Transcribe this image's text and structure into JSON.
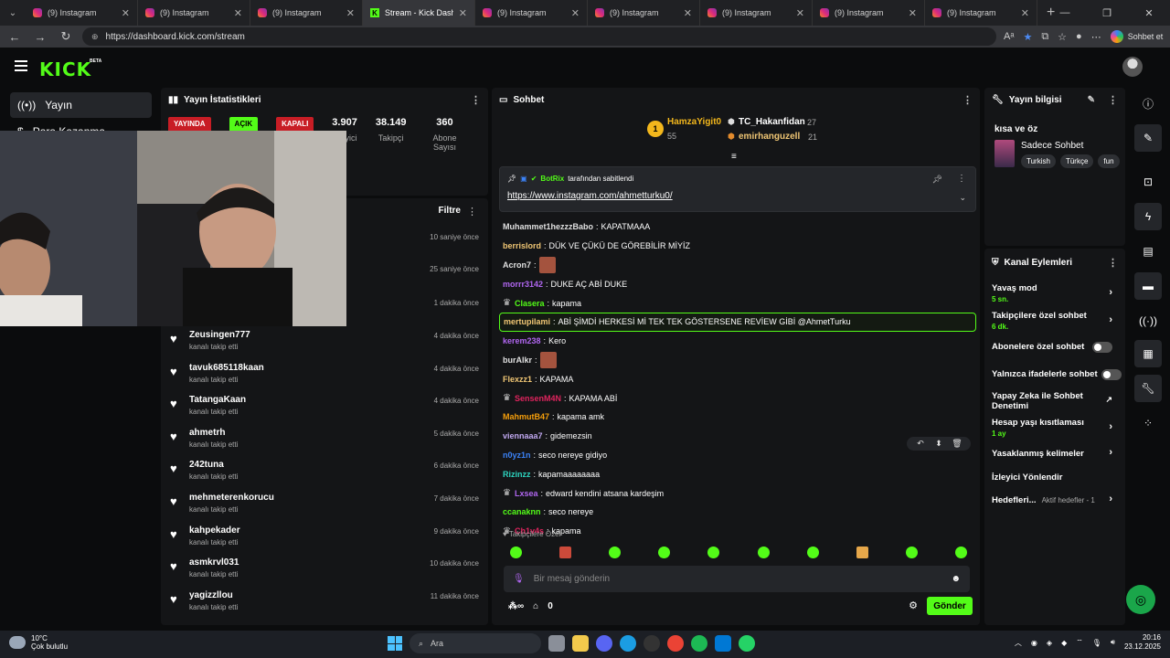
{
  "browser": {
    "tabs": [
      {
        "title": "(9) Instagram",
        "active": false,
        "icon": "instagram-icon"
      },
      {
        "title": "(9) Instagram",
        "active": false,
        "icon": "instagram-icon"
      },
      {
        "title": "(9) Instagram",
        "active": false,
        "icon": "instagram-icon"
      },
      {
        "title": "Stream - Kick Dashboard",
        "active": true,
        "icon": "kick-icon"
      },
      {
        "title": "(9) Instagram",
        "active": false,
        "icon": "instagram-icon"
      },
      {
        "title": "(9) Instagram",
        "active": false,
        "icon": "instagram-icon"
      },
      {
        "title": "(9) Instagram",
        "active": false,
        "icon": "instagram-icon"
      },
      {
        "title": "(9) Instagram",
        "active": false,
        "icon": "instagram-icon"
      },
      {
        "title": "(9) Instagram",
        "active": false,
        "icon": "instagram-icon"
      }
    ],
    "url": "https://dashboard.kick.com/stream",
    "profile_label": "Sohbet et"
  },
  "app": {
    "logo": "KICK",
    "beta": "BETA",
    "nav": {
      "yayin": "Yayın",
      "para": "Para Kazanma"
    }
  },
  "stats": {
    "title": "Yayın İstatistikleri",
    "badge_live": "YAYINDA",
    "badge_open": "AÇIK",
    "badge_closed": "KAPALI",
    "viewers": "3.907",
    "viewers_label": "İzleyici",
    "followers": "38.149",
    "followers_label": "Takipçi",
    "subs": "360",
    "subs_label": "Abone Sayısı"
  },
  "follows": {
    "filter_label": "Filtre",
    "early_times": [
      "10 saniye önce",
      "25 saniye önce",
      "1 dakika önce"
    ],
    "items": [
      {
        "name": "Zeusingen777",
        "sub": "kanalı takip etti",
        "time": "4 dakika önce"
      },
      {
        "name": "tavuk685118kaan",
        "sub": "kanalı takip etti",
        "time": "4 dakika önce"
      },
      {
        "name": "TatangaKaan",
        "sub": "kanalı takip etti",
        "time": "4 dakika önce"
      },
      {
        "name": "ahmetrh",
        "sub": "kanalı takip etti",
        "time": "5 dakika önce"
      },
      {
        "name": "242tuna",
        "sub": "kanalı takip etti",
        "time": "6 dakika önce"
      },
      {
        "name": "mehmeterenkorucu",
        "sub": "kanalı takip etti",
        "time": "7 dakika önce"
      },
      {
        "name": "kahpekader",
        "sub": "kanalı takip etti",
        "time": "9 dakika önce"
      },
      {
        "name": "asmkrvl031",
        "sub": "kanalı takip etti",
        "time": "10 dakika önce"
      },
      {
        "name": "yagizzllou",
        "sub": "kanalı takip etti",
        "time": "11 dakika önce"
      }
    ]
  },
  "chat": {
    "title": "Sohbet",
    "gifters": {
      "first_name": "HamzaYigit0",
      "first_count": "55",
      "first_rank": "1",
      "second_name": "TC_Hakanfidan",
      "second_count": "27",
      "third_name": "emirhanguzell",
      "third_count": "21"
    },
    "pinned": {
      "by": "BotRix",
      "suffix": "tarafından sabitlendi",
      "link": "https://www.instagram.com/ahmetturku0/"
    },
    "messages": [
      {
        "user": "Muhammet1hezzzBabo",
        "text": "KAPATMAAA",
        "color": "#e0e0e0",
        "icon": "",
        "emote": false,
        "highlight": false
      },
      {
        "user": "berrislord",
        "text": "DÜK VE ÇÜKÜ DE GÖREBİLİR MİYİZ",
        "color": "#f0c674",
        "icon": "",
        "emote": false,
        "highlight": false
      },
      {
        "user": "Acron7",
        "text": "",
        "color": "#e0e0e0",
        "icon": "",
        "emote": true,
        "highlight": false
      },
      {
        "user": "morrr3142",
        "text": "DUKE AÇ ABİ DUKE",
        "color": "#b066f0",
        "icon": "",
        "emote": false,
        "highlight": false
      },
      {
        "user": "Clasera",
        "text": "kapama",
        "color": "#53fc18",
        "icon": "crown",
        "emote": false,
        "highlight": false
      },
      {
        "user": "mertupilami",
        "text": "ABİ ŞİMDİ HERKESİ Mİ TEK TEK GÖSTERSENE REVİEW GİBİ @AhmetTurku",
        "color": "#f0c674",
        "icon": "",
        "emote": false,
        "highlight": true
      },
      {
        "user": "kerem238",
        "text": "Kero",
        "color": "#b066f0",
        "icon": "",
        "emote": false,
        "highlight": false
      },
      {
        "user": "burAlkr",
        "text": "",
        "color": "#e0e0e0",
        "icon": "",
        "emote": true,
        "highlight": false
      },
      {
        "user": "Flexzz1",
        "text": "KAPAMA",
        "color": "#f0c674",
        "icon": "",
        "emote": false,
        "highlight": false
      },
      {
        "user": "SensenM4N",
        "text": "KAPAMA ABİ",
        "color": "#e0245e",
        "icon": "crown",
        "emote": false,
        "highlight": false
      },
      {
        "user": "MahmutB47",
        "text": "kapama amk",
        "color": "#f59e0b",
        "icon": "",
        "emote": false,
        "highlight": false
      },
      {
        "user": "viennaaa7",
        "text": "gidemezsin",
        "color": "#c0a8f0",
        "icon": "",
        "emote": false,
        "highlight": false
      },
      {
        "user": "n0yz1n",
        "text": "seco nereye gidiyo",
        "color": "#3b82f6",
        "icon": "",
        "emote": false,
        "highlight": false
      },
      {
        "user": "Rizinzz",
        "text": "kapamaaaaaaaa",
        "color": "#2dd4bf",
        "icon": "",
        "emote": false,
        "highlight": false
      },
      {
        "user": "Lxsea",
        "text": "edward kendini atsana kardeşim",
        "color": "#b066f0",
        "icon": "crown",
        "emote": false,
        "highlight": false
      },
      {
        "user": "ccanaknn",
        "text": "seco nereye",
        "color": "#53fc18",
        "icon": "",
        "emote": false,
        "highlight": false
      },
      {
        "user": "Ch1v4s",
        "text": "kapama",
        "color": "#e0245e",
        "icon": "crown",
        "emote": false,
        "highlight": false
      }
    ],
    "followers_only": "Takipçilere Özel",
    "input_placeholder": "Bir mesaj gönderin",
    "footer_count": "0",
    "send_label": "Gönder"
  },
  "info": {
    "title": "Yayın bilgisi",
    "stream_title": "kısa ve öz",
    "category": "Sadece Sohbet",
    "tags": [
      "Turkish",
      "Türkçe",
      "fun"
    ]
  },
  "actions": {
    "title": "Kanal Eylemleri",
    "slow_mode": "Yavaş mod",
    "slow_mode_val": "5 sn.",
    "followers_chat": "Takipçilere özel sohbet",
    "followers_chat_val": "6 dk.",
    "subs_chat": "Abonelere özel sohbet",
    "emote_only": "Yalnızca ifadelerle sohbet",
    "ai_mod": "Yapay Zeka ile Sohbet Denetimi",
    "age": "Hesap yaşı kısıtlaması",
    "age_val": "1 ay",
    "banned": "Yasaklanmış kelimeler",
    "raid": "İzleyici Yönlendir",
    "goals": "Hedefleri...",
    "goals_val": "Aktif hedefler - 1"
  },
  "taskbar": {
    "temp": "10°C",
    "weather": "Çok bulutlu",
    "search": "Ara",
    "time": "20:16",
    "date": "23.12.2025"
  }
}
